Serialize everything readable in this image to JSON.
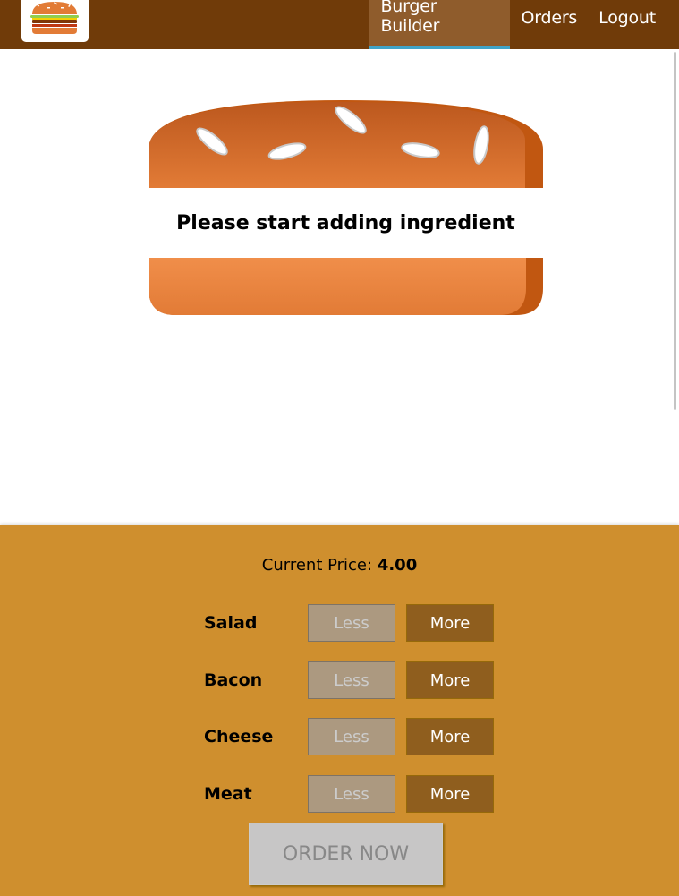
{
  "nav": {
    "items": [
      {
        "label": "Burger Builder",
        "active": true
      },
      {
        "label": "Orders",
        "active": false
      },
      {
        "label": "Logout",
        "active": false
      }
    ]
  },
  "burger": {
    "message": "Please start adding ingredient"
  },
  "controls": {
    "price_label": "Current Price:",
    "price_value": "4.00",
    "items": [
      {
        "label": "Salad",
        "less": "Less",
        "more": "More"
      },
      {
        "label": "Bacon",
        "less": "Less",
        "more": "More"
      },
      {
        "label": "Cheese",
        "less": "Less",
        "more": "More"
      },
      {
        "label": "Meat",
        "less": "Less",
        "more": "More"
      }
    ],
    "order_button": "ORDER NOW"
  },
  "colors": {
    "toolbar": "#703b09",
    "nav_active": "#8f5c2c",
    "nav_active_underline": "#40a4c8",
    "controls_bg": "#cf8f2e",
    "less_button": "#ac9980",
    "more_button": "#8f5e1e",
    "order_button_disabled": "#c7c6c6"
  }
}
